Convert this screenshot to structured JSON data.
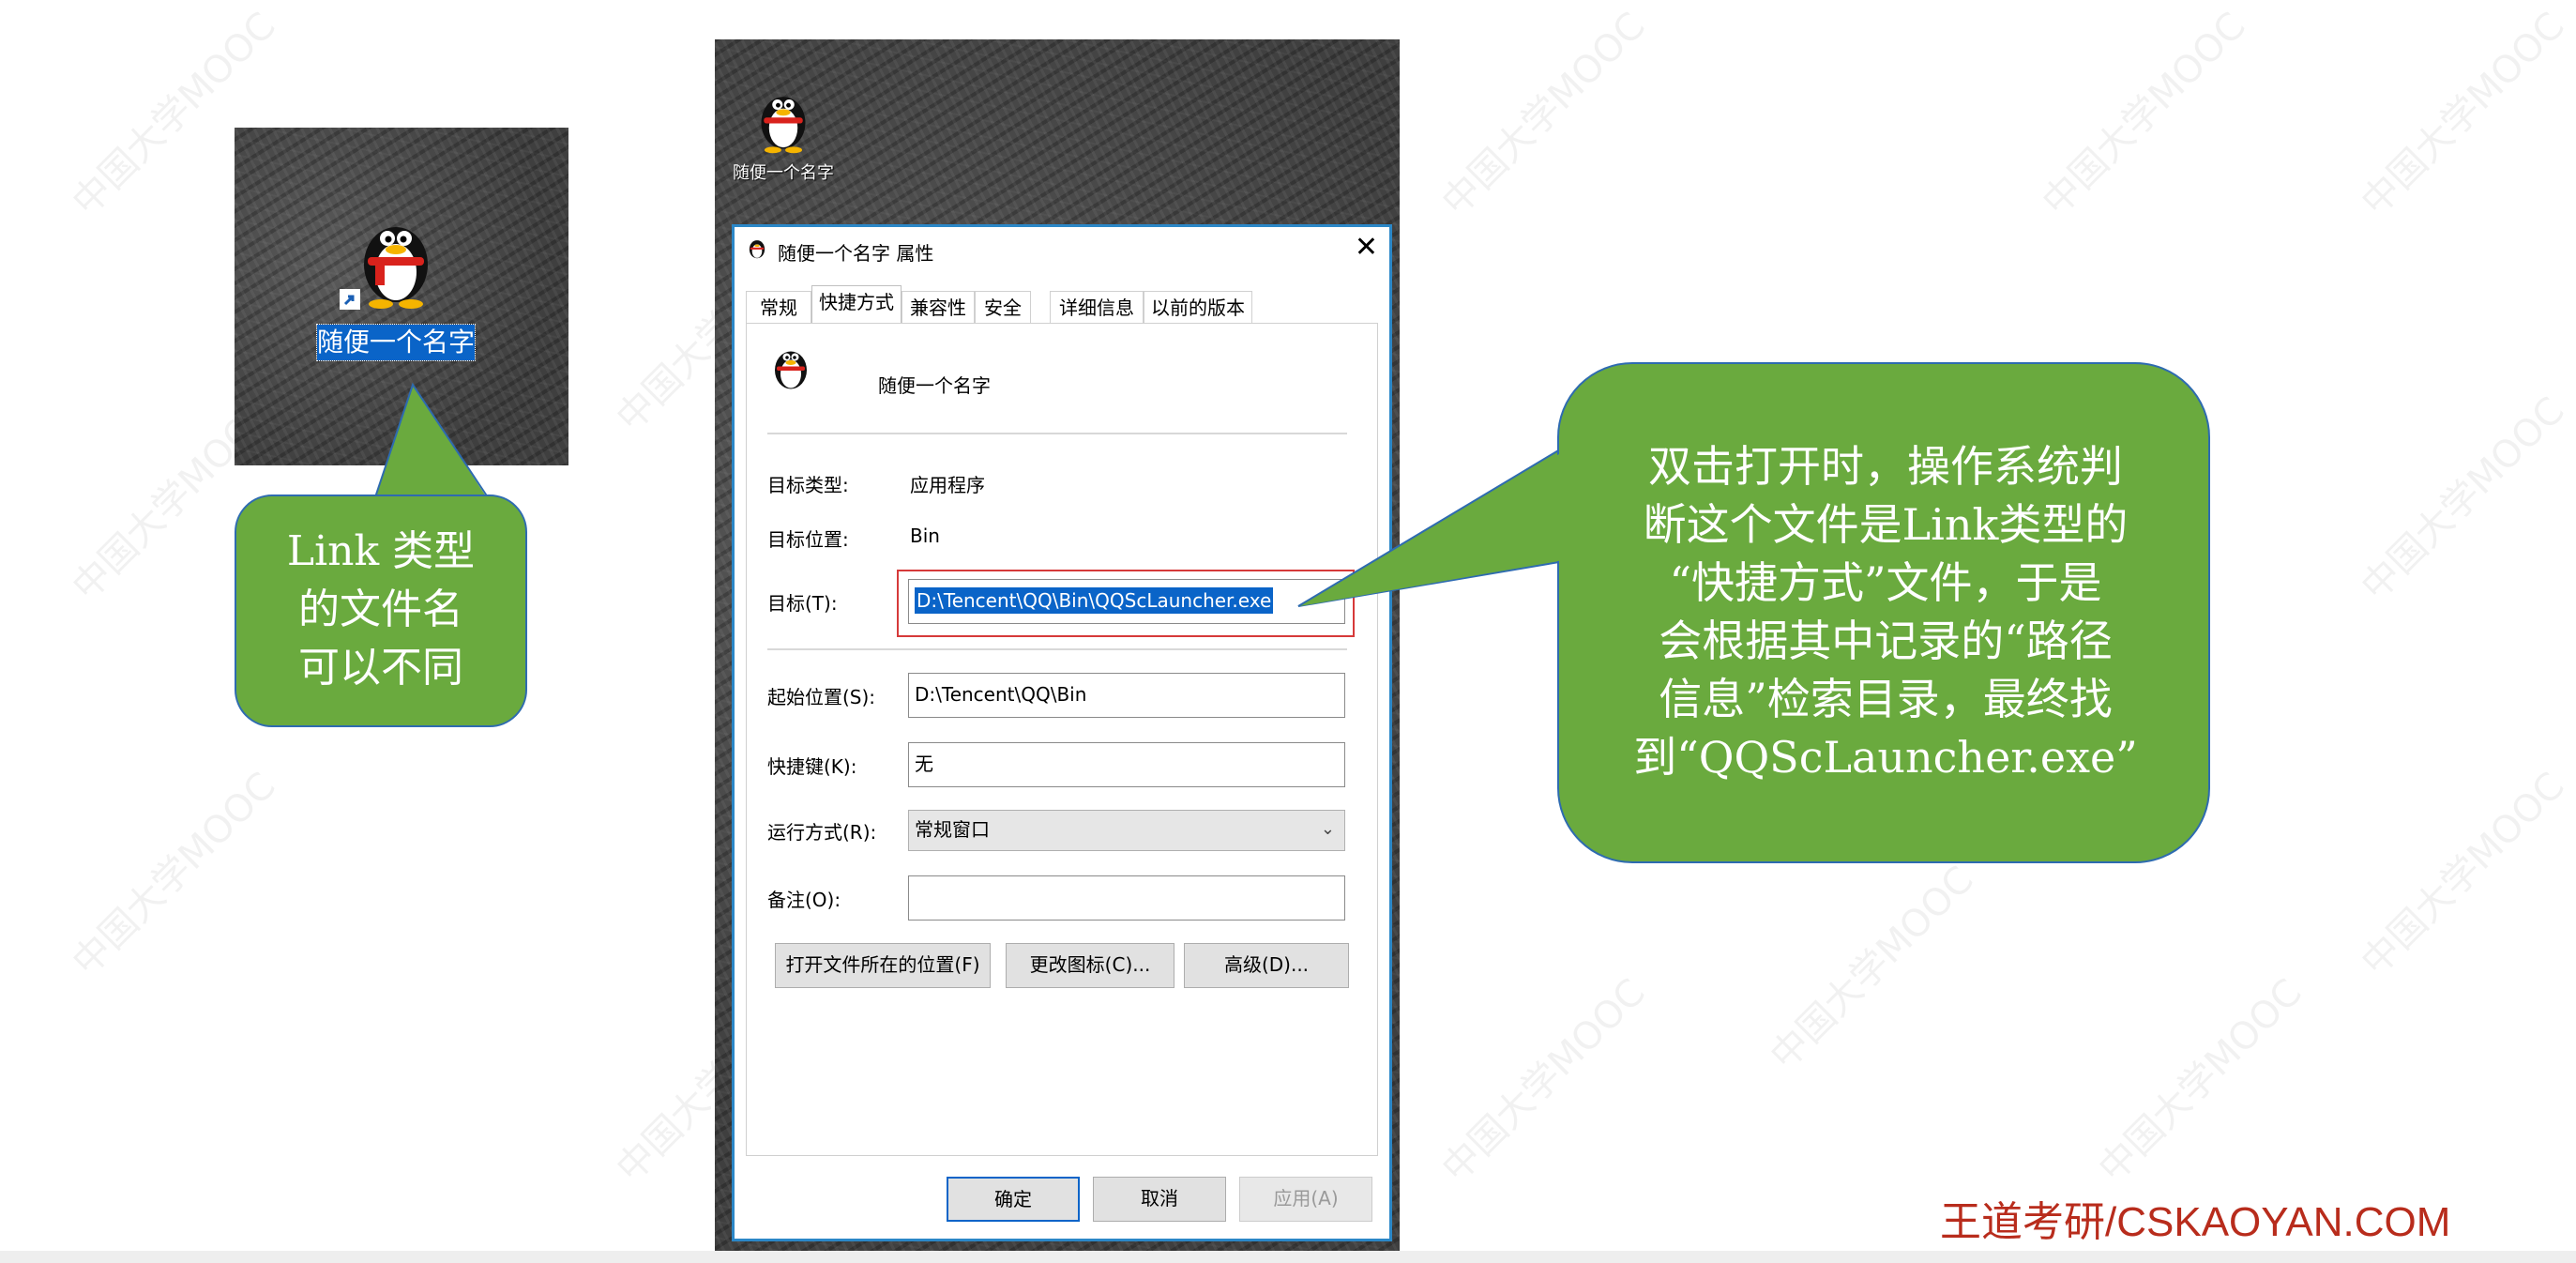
{
  "left_thumbnail": {
    "label": "随便一个名字"
  },
  "left_callout": {
    "lines": [
      "Link 类型",
      "的文件名",
      "可以不同"
    ]
  },
  "desktop_icon": {
    "name": "随便一个名字"
  },
  "dialog": {
    "title": "随便一个名字 属性",
    "close": "✕",
    "tabs": [
      "常规",
      "快捷方式",
      "兼容性",
      "安全",
      "详细信息",
      "以前的版本"
    ],
    "active_tab": "快捷方式",
    "shortcut_name": "随便一个名字",
    "target_type_label": "目标类型:",
    "target_type_value": "应用程序",
    "target_location_label": "目标位置:",
    "target_location_value": "Bin",
    "target_label": "目标(T):",
    "target_value": "D:\\Tencent\\QQ\\Bin\\QQScLauncher.exe",
    "start_in_label": "起始位置(S):",
    "start_in_value": "D:\\Tencent\\QQ\\Bin",
    "hotkey_label": "快捷键(K):",
    "hotkey_value": "无",
    "run_label": "运行方式(R):",
    "run_value": "常规窗口",
    "comment_label": "备注(O):",
    "comment_value": "",
    "btn_open_location": "打开文件所在的位置(F)",
    "btn_change_icon": "更改图标(C)...",
    "btn_advanced": "高级(D)...",
    "btn_ok": "确定",
    "btn_cancel": "取消",
    "btn_apply": "应用(A)"
  },
  "right_callout": {
    "lines": [
      "双击打开时，操作系统判",
      "断这个文件是Link类型的",
      "“快捷方式”文件，于是",
      "会根据其中记录的“路径",
      "信息”检索目录，最终找",
      "到“QQScLauncher.exe”"
    ]
  },
  "brand": "王道考研/CSKAOYAN.COM",
  "watermark": "中国大学MOOC",
  "colors": {
    "callout_fill": "#6aaa3e",
    "callout_border": "#2e6bb0",
    "selection": "#0a64c8",
    "brand": "#b82c1c",
    "highlight_box": "#d63a3a"
  }
}
